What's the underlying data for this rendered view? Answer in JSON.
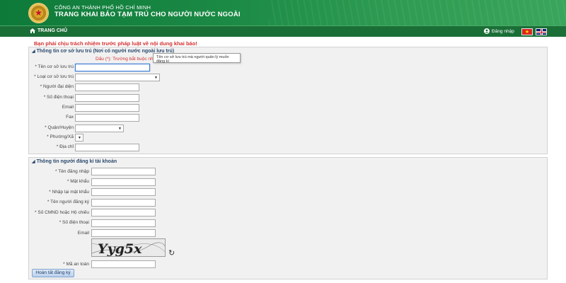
{
  "header": {
    "org": "CÔNG AN THÀNH PHỐ HỒ CHÍ MINH",
    "site_title": "TRANG KHAI BÁO TẠM TRÚ CHO NGƯỜI NƯỚC NGOÀI"
  },
  "nav": {
    "home": "TRANG CHỦ",
    "login": "Đăng nhập",
    "flags": [
      "vn-flag-icon",
      "uk-flag-icon"
    ]
  },
  "warning": "Bạn phải chịu trách nhiệm trước pháp luật về nội dung khai báo!",
  "section1": {
    "title": "Thông tin cơ sở lưu trú (Nơi có người nước ngoài lưu trú)",
    "required_note": "Dấu (*): Trường bắt buộc nhập",
    "tooltip": "Tên cơ sở lưu trú mà người quản lý muốn đăng kí",
    "fields": {
      "name": "* Tên cơ sở lưu trú",
      "type": "* Loại cơ sở lưu trú",
      "rep": "* Người đại diện",
      "phone": "* Số điện thoại",
      "email": "Email",
      "fax": "Fax",
      "district": "* Quận/Huyện",
      "ward": "* Phường/Xã",
      "address": "* Địa chỉ"
    }
  },
  "section2": {
    "title": "Thông tin người đăng kí tài khoản",
    "fields": {
      "username": "* Tên đăng nhập",
      "password": "* Mật khẩu",
      "password2": "* Nhập lại mật khẩu",
      "fullname": "* Tên người đăng ký",
      "idno": "* Số CMND hoặc Hộ chiếu",
      "phone": "* Số điện thoại",
      "email": "Email",
      "captcha_code": "* Mã an toàn"
    },
    "captcha_text": "Yyg5x",
    "submit": "Hoàn tất đăng ký"
  }
}
